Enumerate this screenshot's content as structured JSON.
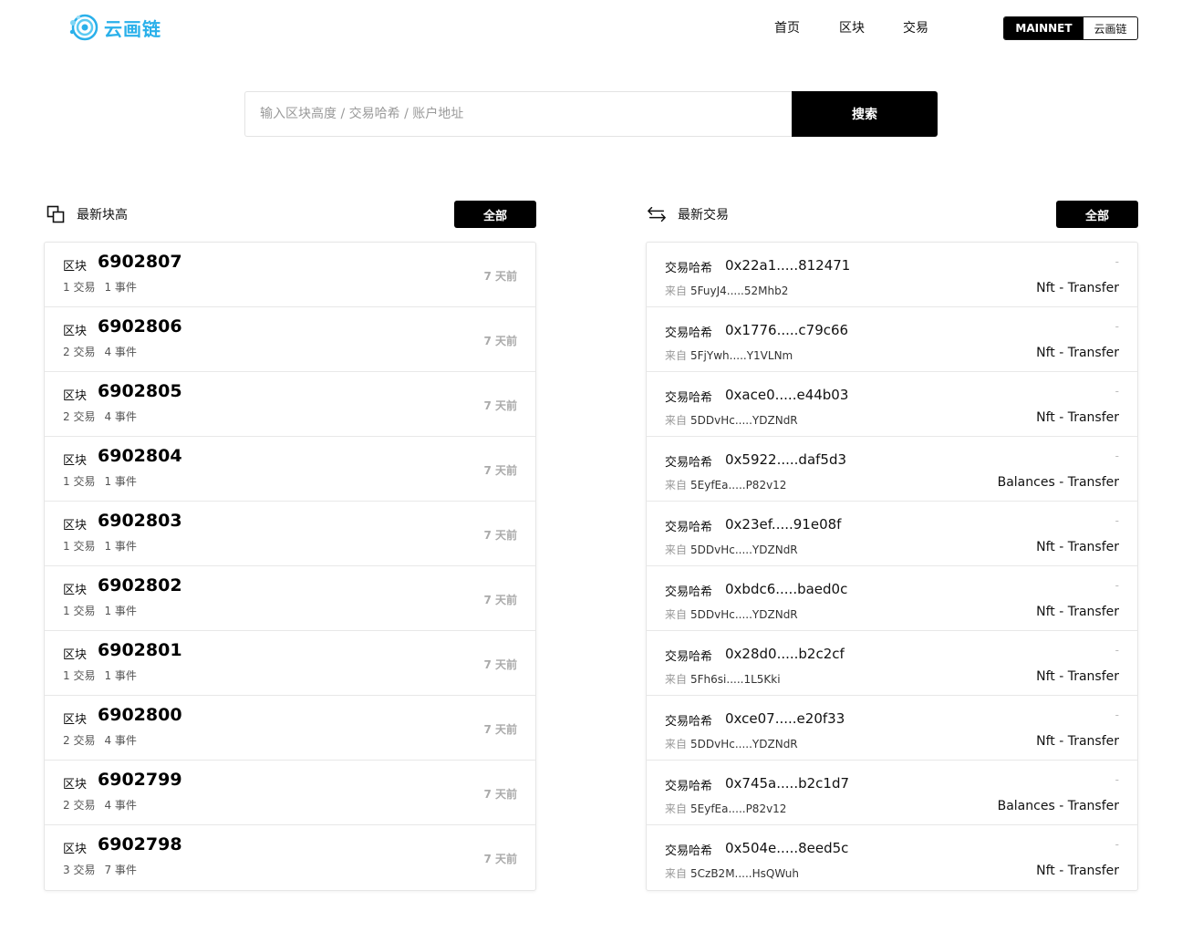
{
  "brand": {
    "name": "云画链",
    "color": "#2ab0ea"
  },
  "nav": {
    "home": "首页",
    "blocks": "区块",
    "transactions": "交易"
  },
  "network": {
    "active": "MAINNET",
    "chain": "云画链"
  },
  "search": {
    "placeholder": "输入区块高度 / 交易哈希 / 账户地址",
    "button": "搜索"
  },
  "blocks_section": {
    "title": "最新块高",
    "all_label": "全部",
    "icon": "blocks-icon"
  },
  "tx_section": {
    "title": "最新交易",
    "all_label": "全部",
    "icon": "transfer-arrows-icon"
  },
  "blocks": [
    {
      "label": "区块",
      "number": "6902807",
      "tx": "1 交易",
      "events": "1 事件",
      "time": "7 天前"
    },
    {
      "label": "区块",
      "number": "6902806",
      "tx": "2 交易",
      "events": "4 事件",
      "time": "7 天前"
    },
    {
      "label": "区块",
      "number": "6902805",
      "tx": "2 交易",
      "events": "4 事件",
      "time": "7 天前"
    },
    {
      "label": "区块",
      "number": "6902804",
      "tx": "1 交易",
      "events": "1 事件",
      "time": "7 天前"
    },
    {
      "label": "区块",
      "number": "6902803",
      "tx": "1 交易",
      "events": "1 事件",
      "time": "7 天前"
    },
    {
      "label": "区块",
      "number": "6902802",
      "tx": "1 交易",
      "events": "1 事件",
      "time": "7 天前"
    },
    {
      "label": "区块",
      "number": "6902801",
      "tx": "1 交易",
      "events": "1 事件",
      "time": "7 天前"
    },
    {
      "label": "区块",
      "number": "6902800",
      "tx": "2 交易",
      "events": "4 事件",
      "time": "7 天前"
    },
    {
      "label": "区块",
      "number": "6902799",
      "tx": "2 交易",
      "events": "4 事件",
      "time": "7 天前"
    },
    {
      "label": "区块",
      "number": "6902798",
      "tx": "3 交易",
      "events": "7 事件",
      "time": "7 天前"
    }
  ],
  "transactions": [
    {
      "label": "交易哈希",
      "hash": "0x22a1.....812471",
      "time": "-",
      "from_label": "来自",
      "from": "5FuyJ4.....52Mhb2",
      "type": "Nft - Transfer"
    },
    {
      "label": "交易哈希",
      "hash": "0x1776.....c79c66",
      "time": "-",
      "from_label": "来自",
      "from": "5FjYwh.....Y1VLNm",
      "type": "Nft - Transfer"
    },
    {
      "label": "交易哈希",
      "hash": "0xace0.....e44b03",
      "time": "-",
      "from_label": "来自",
      "from": "5DDvHc.....YDZNdR",
      "type": "Nft - Transfer"
    },
    {
      "label": "交易哈希",
      "hash": "0x5922.....daf5d3",
      "time": "-",
      "from_label": "来自",
      "from": "5EyfEa.....P82v12",
      "type": "Balances - Transfer"
    },
    {
      "label": "交易哈希",
      "hash": "0x23ef.....91e08f",
      "time": "-",
      "from_label": "来自",
      "from": "5DDvHc.....YDZNdR",
      "type": "Nft - Transfer"
    },
    {
      "label": "交易哈希",
      "hash": "0xbdc6.....baed0c",
      "time": "-",
      "from_label": "来自",
      "from": "5DDvHc.....YDZNdR",
      "type": "Nft - Transfer"
    },
    {
      "label": "交易哈希",
      "hash": "0x28d0.....b2c2cf",
      "time": "-",
      "from_label": "来自",
      "from": "5Fh6si.....1L5Kki",
      "type": "Nft - Transfer"
    },
    {
      "label": "交易哈希",
      "hash": "0xce07.....e20f33",
      "time": "-",
      "from_label": "来自",
      "from": "5DDvHc.....YDZNdR",
      "type": "Nft - Transfer"
    },
    {
      "label": "交易哈希",
      "hash": "0x745a.....b2c1d7",
      "time": "-",
      "from_label": "来自",
      "from": "5EyfEa.....P82v12",
      "type": "Balances - Transfer"
    },
    {
      "label": "交易哈希",
      "hash": "0x504e.....8eed5c",
      "time": "-",
      "from_label": "来自",
      "from": "5CzB2M.....HsQWuh",
      "type": "Nft - Transfer"
    }
  ]
}
